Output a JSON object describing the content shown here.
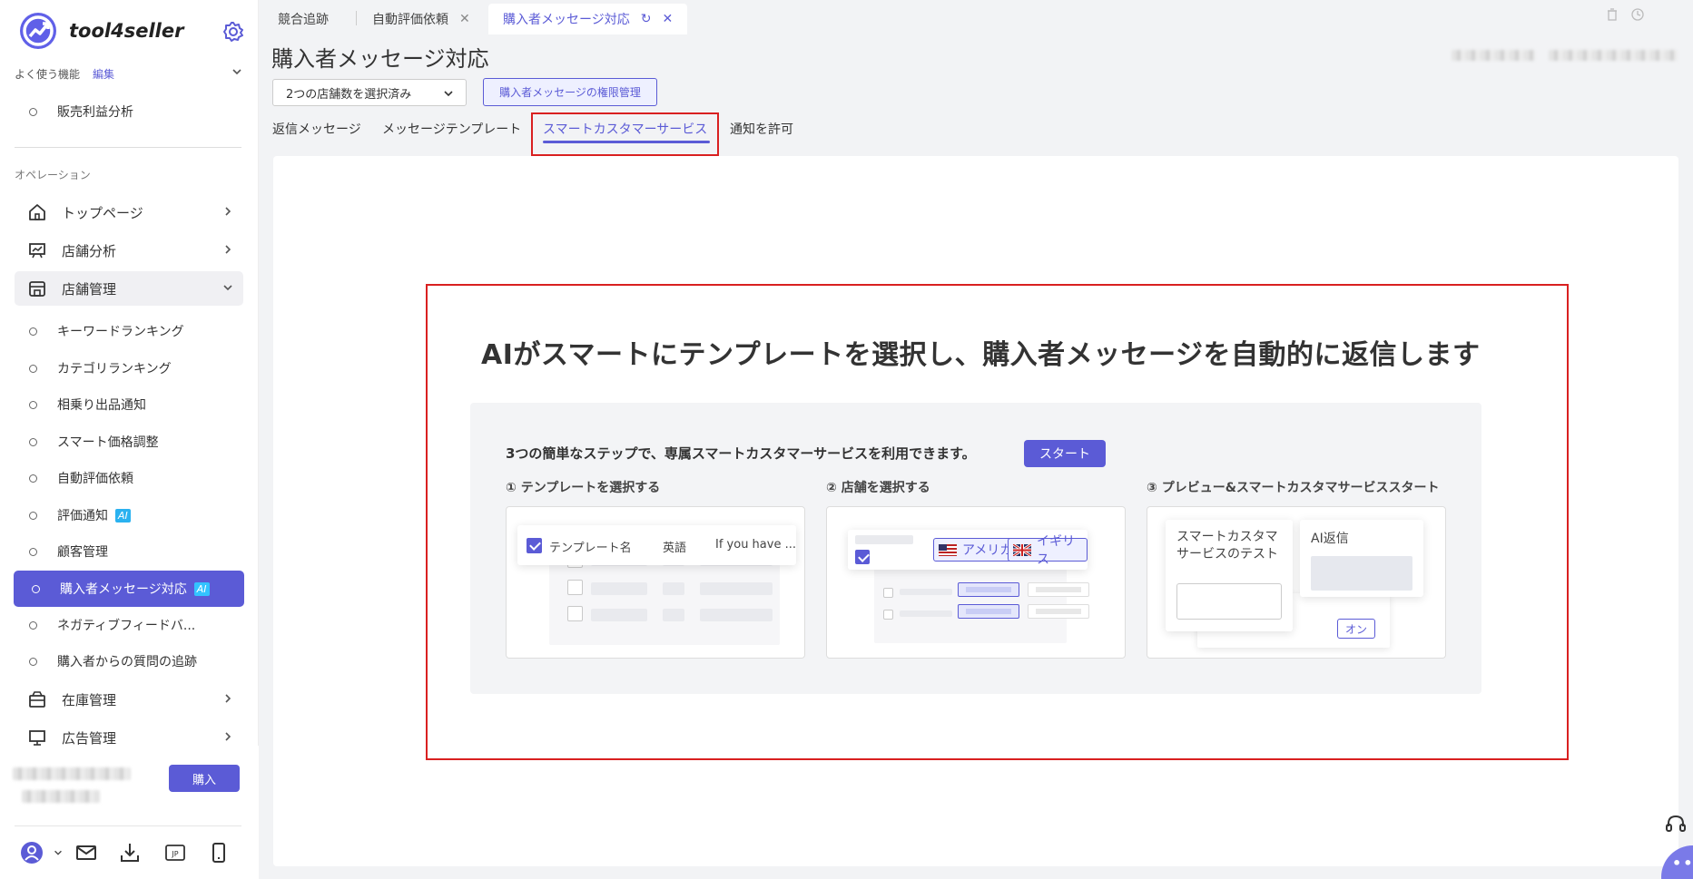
{
  "app": {
    "brand": "tool4seller"
  },
  "sidebar": {
    "favorites_label": "よく使う機能",
    "favorites_edit": "編集",
    "favorite_items": [
      "販売利益分析"
    ],
    "section_label": "オペレーション",
    "nav": {
      "home": "トップページ",
      "store_analysis": "店舗分析",
      "store_management": "店舗管理",
      "inventory": "在庫管理",
      "ads": "広告管理"
    },
    "store_sub_items": [
      "キーワードランキング",
      "カテゴリランキング",
      "相乗り出品通知",
      "スマート価格調整",
      "自動評価依頼",
      "評価通知",
      "顧客管理",
      "購入者メッセージ対応",
      "ネガティブフィードバ...",
      "購入者からの質問の追跡"
    ],
    "ai_badge": "AI",
    "buy_button": "購入"
  },
  "tabs": {
    "items": [
      "競合追跡",
      "自動評価依頼",
      "購入者メッセージ対応"
    ],
    "close_glyph": "✕",
    "refresh_glyph": "↻"
  },
  "page": {
    "title": "購入者メッセージ対応",
    "store_select": "2つの店舗数を選択済み",
    "permission_button": "購入者メッセージの権限管理",
    "subtabs": [
      "返信メッセージ",
      "メッセージテンプレート",
      "スマートカスタマーサービス",
      "通知を許可"
    ]
  },
  "main": {
    "headline": "AIがスマートにテンプレートを選択し、購入者メッセージを自動的に返信します",
    "intro": "3つの簡単なステップで、専属スマートカスタマーサービスを利用できます。",
    "start_button": "スタート",
    "steps": [
      {
        "label": "① テンプレートを選択する"
      },
      {
        "label": "② 店舗を選択する"
      },
      {
        "label": "③ プレビュー&スマートカスタマサービススタート"
      }
    ],
    "step1": {
      "col_name": "テンプレート名",
      "col_lang": "英語",
      "col_text": "If you have ..."
    },
    "step2": {
      "us": "アメリカ",
      "uk": "イギリス"
    },
    "step3": {
      "test_title": "スマートカスタマサービスのテスト",
      "ai_reply": "AI返信",
      "on": "オン"
    }
  },
  "colors": {
    "accent": "#5b5bd6",
    "highlight_border": "#d92020",
    "ai_badge": "#2ab2f0"
  }
}
